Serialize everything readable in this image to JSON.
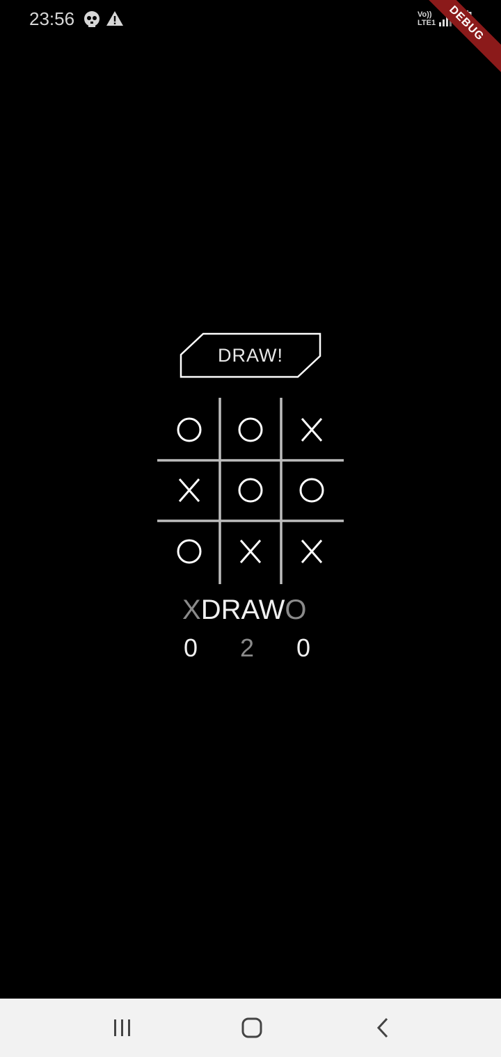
{
  "status_bar": {
    "time": "23:56",
    "left_icons": [
      "skull-icon",
      "warning-icon"
    ],
    "network_label_top": "Vo))",
    "network_label_bottom": "LTE1",
    "right_icons": [
      "signal-icon",
      "battery-icon"
    ]
  },
  "debug_banner": {
    "label": "DEBUG"
  },
  "game": {
    "result_label": "DRAW!",
    "board": [
      [
        "O",
        "O",
        "X"
      ],
      [
        "X",
        "O",
        "O"
      ],
      [
        "O",
        "X",
        "X"
      ]
    ]
  },
  "scoreboard": {
    "x_label": "X",
    "draw_label": "DRAW",
    "o_label": "O",
    "x_score": "0",
    "draw_score": "2",
    "o_score": "0"
  },
  "colors": {
    "background": "#000000",
    "foreground": "#ffffff",
    "muted": "#8a8a8a",
    "grid": "#bdbdbd",
    "debug": "#8b1a1a",
    "nav_bar": "#f2f2f2"
  },
  "nav_bar": {
    "icons": [
      "recent-apps-icon",
      "home-icon",
      "back-icon"
    ]
  }
}
